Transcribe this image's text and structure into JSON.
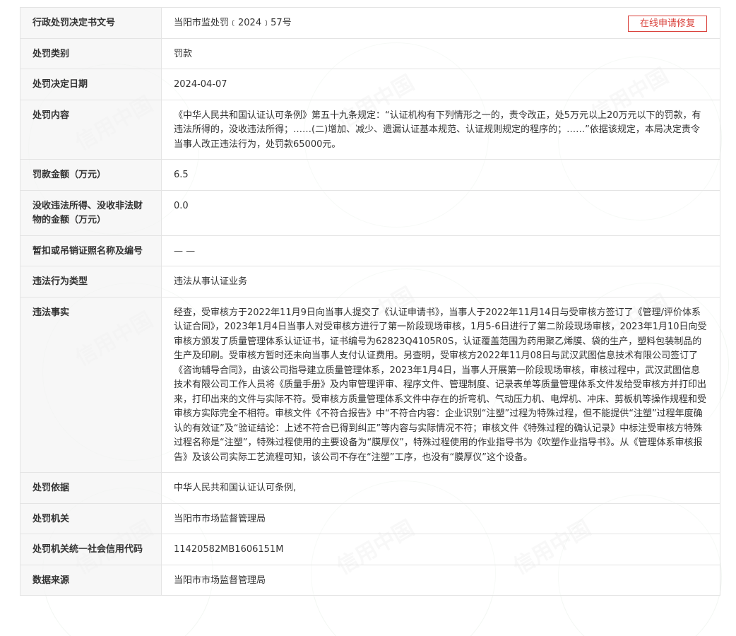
{
  "header": {
    "apply_button_label": "在线申请修复"
  },
  "watermark": {
    "text": "信用中国"
  },
  "rows": [
    {
      "label": "行政处罚决定书文号",
      "value": "当阳市监处罚﹝2024﹞57号"
    },
    {
      "label": "处罚类别",
      "value": "罚款"
    },
    {
      "label": "处罚决定日期",
      "value": "2024-04-07"
    },
    {
      "label": "处罚内容",
      "value": "《中华人民共和国认证认可条例》第五十九条规定：“认证机构有下列情形之一的，责令改正，处5万元以上20万元以下的罚款，有违法所得的，没收违法所得；……(二)增加、减少、遗漏认证基本规范、认证规则规定的程序的；……”依据该规定，本局决定责令当事人改正违法行为，处罚款65000元。"
    },
    {
      "label": "罚款金额（万元）",
      "value": "6.5"
    },
    {
      "label": "没收违法所得、没收非法财物的金额（万元）",
      "value": "0.0"
    },
    {
      "label": "暂扣或吊销证照名称及编号",
      "value": "— —"
    },
    {
      "label": "违法行为类型",
      "value": "违法从事认证业务"
    },
    {
      "label": "违法事实",
      "value": "经查，受审核方于2022年11月9日向当事人提交了《认证申请书》，当事人于2022年11月14日与受审核方签订了《管理/评价体系认证合同》，2023年1月4日当事人对受审核方进行了第一阶段现场审核，1月5-6日进行了第二阶段现场审核，2023年1月10日向受审核方颁发了质量管理体系认证证书，证书编号为62823Q4105R0S，认证覆盖范围为药用聚乙烯膜、袋的生产，塑料包装制品的生产及印刷。受审核方暂时还未向当事人支付认证费用。另查明，受审核方2022年11月08日与武汉武图信息技术有限公司签订了《咨询辅导合同》，由该公司指导建立质量管理体系，2023年1月4日，当事人开展第一阶段现场审核，审核过程中，武汉武图信息技术有限公司工作人员将《质量手册》及内审管理评审、程序文件、管理制度、记录表单等质量管理体系文件发给受审核方并打印出来，打印出来的文件与实际不符。受审核方质量管理体系文件中存在的折弯机、气动压力机、电焊机、冲床、剪板机等操作规程和受审核方实际完全不相符。审核文件《不符合报告》中“不符合内容：企业识别“注塑”过程为特殊过程，但不能提供“注塑”过程年度确认的有效证”及“验证结论：上述不符合已得到纠正”等内容与实际情况不符；审核文件《特殊过程的确认记录》中标注受审核方特殊过程名称是“注塑”，特殊过程使用的主要设备为“膜厚仪”，特殊过程使用的作业指导书为《吹塑作业指导书》。从《管理体系审核报告》及该公司实际工艺流程可知，该公司不存在“注塑”工序，也没有“膜厚仪”这个设备。"
    },
    {
      "label": "处罚依据",
      "value": "中华人民共和国认证认可条例,"
    },
    {
      "label": "处罚机关",
      "value": "当阳市市场监督管理局"
    },
    {
      "label": "处罚机关统一社会信用代码",
      "value": "11420582MB1606151M"
    },
    {
      "label": "数据来源",
      "value": "当阳市市场监督管理局"
    }
  ]
}
